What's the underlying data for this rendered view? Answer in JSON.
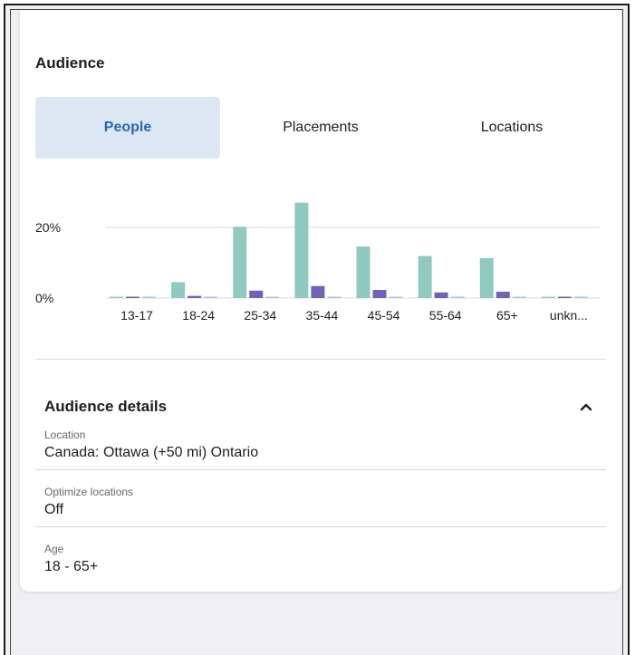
{
  "audience": {
    "title": "Audience",
    "tabs": [
      {
        "label": "People",
        "active": true
      },
      {
        "label": "Placements",
        "active": false
      },
      {
        "label": "Locations",
        "active": false
      }
    ]
  },
  "chart_data": {
    "type": "bar",
    "categories": [
      "13-17",
      "18-24",
      "25-34",
      "35-44",
      "45-54",
      "55-64",
      "65+",
      "unkn..."
    ],
    "series": [
      {
        "color": "#8fc9bf",
        "values": [
          0.2,
          4.5,
          20.2,
          27.0,
          14.6,
          11.9,
          11.3,
          0.2
        ]
      },
      {
        "color": "#6f63b8",
        "values": [
          0.3,
          0.6,
          2.1,
          3.4,
          2.3,
          1.6,
          1.8,
          0.3
        ]
      },
      {
        "color": "#a9c4e6",
        "values": [
          0.2,
          0.2,
          0.3,
          0.3,
          0.2,
          0.2,
          0.2,
          0.2
        ]
      }
    ],
    "ytick_labels": [
      "0%",
      "20%"
    ],
    "ylim": [
      0,
      30
    ],
    "grid": true
  },
  "details": {
    "title": "Audience details",
    "fields": [
      {
        "label": "Location",
        "value": "Canada: Ottawa (+50 mi) Ontario"
      },
      {
        "label": "Optimize locations",
        "value": "Off"
      },
      {
        "label": "Age",
        "value": "18 - 65+"
      }
    ]
  },
  "colors": {
    "active_tab_bg": "#dde7f3",
    "active_tab_text": "#2b68b3",
    "page_bg": "#efeff3"
  }
}
